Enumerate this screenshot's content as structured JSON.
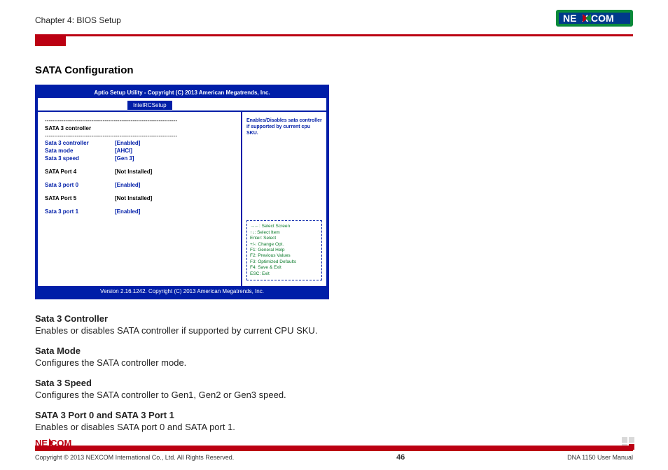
{
  "header": {
    "chapter": "Chapter 4: BIOS Setup",
    "brand": "NEXCOM"
  },
  "title": "SATA Configuration",
  "bios": {
    "titlebar": "Aptio Setup Utility - Copyright (C) 2013 American Megatrends, Inc.",
    "tab": "IntelRCSetup",
    "section_label": "SATA 3 controller",
    "rows": [
      {
        "k": "Sata 3 controller",
        "v": "[Enabled]",
        "cls": "blue-b"
      },
      {
        "k": "Sata mode",
        "v": "[AHCI]",
        "cls": "blue-b"
      },
      {
        "k": "Sata 3 speed",
        "v": "[Gen 3]",
        "cls": "blue-b"
      },
      {
        "k": "SATA Port 4",
        "v": "[Not Installed]",
        "cls": "black-b",
        "gap": true
      },
      {
        "k": "Sata 3 port 0",
        "v": "[Enabled]",
        "cls": "blue-b",
        "gap": true
      },
      {
        "k": "SATA Port 5",
        "v": "[Not Installed]",
        "cls": "black-b",
        "gap": true
      },
      {
        "k": "Sata 3 port 1",
        "v": "[Enabled]",
        "cls": "blue-b",
        "gap": true
      }
    ],
    "help": "Enables/Disables sata controller if supported by current cpu SKU.",
    "keyhelp": [
      "→←: Select Screen",
      "↑↓: Select Item",
      "Enter: Select",
      "+/-: Change Opt.",
      "F1: General Help",
      "F2: Previous Values",
      "F3: Optimized Defaults",
      "F4: Save & Exit",
      "ESC: Exit"
    ],
    "footer": "Version 2.16.1242. Copyright (C) 2013 American Megatrends, Inc."
  },
  "descriptions": [
    {
      "h": "Sata 3 Controller",
      "p": "Enables or disables SATA controller if supported by current CPU SKU."
    },
    {
      "h": "Sata Mode",
      "p": "Configures the SATA controller mode."
    },
    {
      "h": "Sata 3 Speed",
      "p": "Configures the SATA controller to Gen1, Gen2 or Gen3 speed."
    },
    {
      "h": "SATA 3 Port 0 and SATA 3 Port 1",
      "p": "Enables or disables SATA port 0 and SATA port 1."
    }
  ],
  "footer": {
    "copyright": "Copyright © 2013 NEXCOM International Co., Ltd. All Rights Reserved.",
    "page": "46",
    "manual": "DNA 1150 User Manual"
  }
}
